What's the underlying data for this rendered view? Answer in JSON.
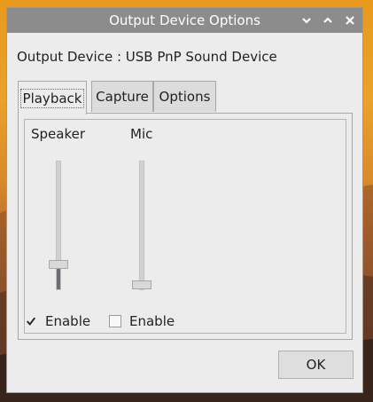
{
  "window": {
    "title": "Output Device Options",
    "controls": {
      "minimize_icon": "chevron-down-icon",
      "maximize_icon": "chevron-up-icon",
      "close_icon": "close-icon"
    }
  },
  "device": {
    "label": "Output Device : USB PnP Sound Device"
  },
  "tabs": [
    {
      "label": "Playback",
      "active": true
    },
    {
      "label": "Capture",
      "active": false
    },
    {
      "label": "Options",
      "active": false
    }
  ],
  "channels": [
    {
      "label": "Speaker",
      "level": 0.17,
      "enabled": true,
      "enable_label": "Enable"
    },
    {
      "label": "Mic",
      "level": 0.0,
      "enabled": false,
      "enable_label": "Enable"
    }
  ],
  "ok_label": "OK",
  "colors": {
    "titlebar": "#8c8c8c",
    "window_bg": "#ececec",
    "slider_fill": "#6b6f74"
  }
}
